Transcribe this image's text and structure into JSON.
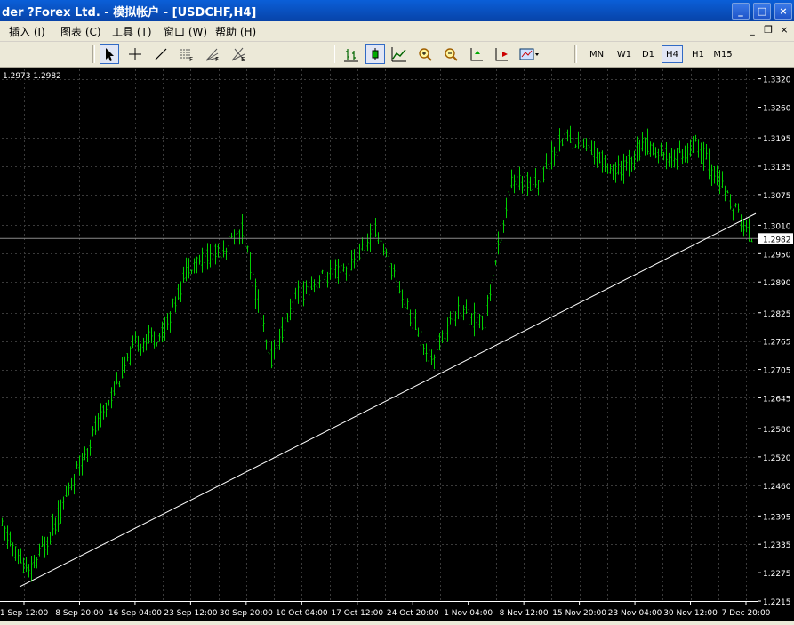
{
  "window": {
    "title": "der ?Forex Ltd. - 模拟帐户 - [USDCHF,H4]"
  },
  "menu": [
    {
      "label": "插入 (I)"
    },
    {
      "label": "图表 (C)"
    },
    {
      "label": "工具 (T)"
    },
    {
      "label": "窗口 (W)"
    },
    {
      "label": "帮助 (H)"
    }
  ],
  "timeframes": [
    "MN",
    "W1",
    "D1",
    "H4",
    "H1",
    "M15"
  ],
  "active_timeframe": "H4",
  "icons": {
    "tools": [
      "cursor-icon",
      "crosshair-icon",
      "trendline-icon",
      "fibo-icon",
      "fibo-fan-icon",
      "gann-icon"
    ],
    "chart": [
      "bar-chart-icon",
      "candle-chart-icon",
      "line-chart-icon",
      "zoom-in-icon",
      "zoom-out-icon",
      "autoscroll-icon",
      "chart-shift-icon",
      "template-icon"
    ]
  },
  "chart": {
    "header": "1.2973 1.2982",
    "current_price": "1.2982",
    "colors": {
      "background": "#000000",
      "bars": "#00d000",
      "grid": "#3a3a3a",
      "axis_text": "#ffffff",
      "trendline": "#ffffff"
    }
  },
  "chart_data": {
    "type": "line",
    "symbol": "USDCHF",
    "timeframe": "H4",
    "y_ticks": [
      1.332,
      1.326,
      1.3195,
      1.3135,
      1.3075,
      1.301,
      1.295,
      1.289,
      1.2825,
      1.2765,
      1.2705,
      1.2645,
      1.258,
      1.252,
      1.246,
      1.2395,
      1.2335,
      1.2275,
      1.2215
    ],
    "ylim": [
      1.2215,
      1.334
    ],
    "x_labels": [
      "1 Sep 12:00",
      "8 Sep 20:00",
      "16 Sep 04:00",
      "23 Sep 12:00",
      "30 Sep 20:00",
      "10 Oct 04:00",
      "17 Oct 12:00",
      "24 Oct 20:00",
      "1 Nov 04:00",
      "8 Nov 12:00",
      "15 Nov 20:00",
      "23 Nov 04:00",
      "30 Nov 12:00",
      "7 Dec 20:00"
    ],
    "series": [
      {
        "approximate_closes": [
          {
            "x": "1 Sep 12:00",
            "y": 1.237
          },
          {
            "x": "2 Sep",
            "y": 1.227
          },
          {
            "x": "4 Sep",
            "y": 1.238
          },
          {
            "x": "8 Sep 20:00",
            "y": 1.252
          },
          {
            "x": "12 Sep",
            "y": 1.264
          },
          {
            "x": "16 Sep 04:00",
            "y": 1.276
          },
          {
            "x": "19 Sep",
            "y": 1.278
          },
          {
            "x": "23 Sep 12:00",
            "y": 1.293
          },
          {
            "x": "27 Sep",
            "y": 1.295
          },
          {
            "x": "30 Sep 20:00",
            "y": 1.3
          },
          {
            "x": "4 Oct",
            "y": 1.272
          },
          {
            "x": "7 Oct",
            "y": 1.286
          },
          {
            "x": "10 Oct 04:00",
            "y": 1.29
          },
          {
            "x": "13 Oct",
            "y": 1.292
          },
          {
            "x": "17 Oct 12:00",
            "y": 1.3
          },
          {
            "x": "20 Oct",
            "y": 1.285
          },
          {
            "x": "24 Oct 20:00",
            "y": 1.273
          },
          {
            "x": "27 Oct",
            "y": 1.283
          },
          {
            "x": "1 Nov 04:00",
            "y": 1.28
          },
          {
            "x": "3 Nov",
            "y": 1.31
          },
          {
            "x": "8 Nov 12:00",
            "y": 1.31
          },
          {
            "x": "12 Nov",
            "y": 1.32
          },
          {
            "x": "15 Nov 20:00",
            "y": 1.317
          },
          {
            "x": "19 Nov",
            "y": 1.312
          },
          {
            "x": "23 Nov 04:00",
            "y": 1.318
          },
          {
            "x": "27 Nov",
            "y": 1.315
          },
          {
            "x": "30 Nov 12:00",
            "y": 1.318
          },
          {
            "x": "4 Dec",
            "y": 1.308
          },
          {
            "x": "7 Dec 20:00",
            "y": 1.2982
          }
        ]
      }
    ],
    "trendline": {
      "from": {
        "x": "2 Sep",
        "y": 1.2245
      },
      "to": {
        "x": "7 Dec 20:00",
        "y": 1.3035
      }
    },
    "grid": true
  }
}
